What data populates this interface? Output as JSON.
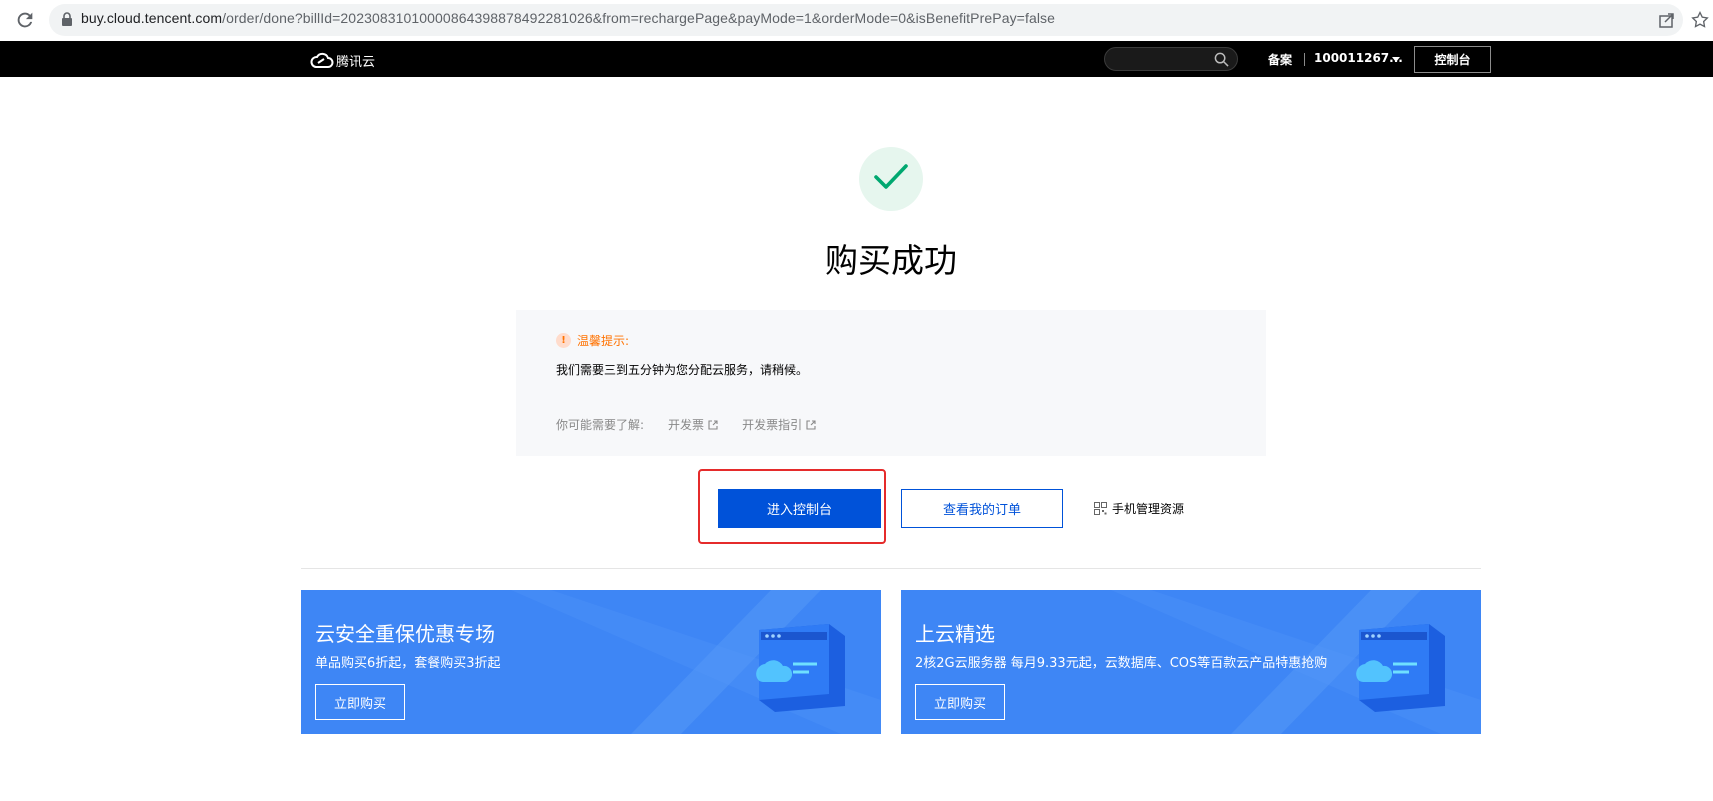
{
  "browser": {
    "url_host": "buy.cloud.tencent.com",
    "url_path": "/order/done?billId=20230831010000864398878492281026&from=rechargePage&payMode=1&orderMode=0&isBenefitPrePay=false"
  },
  "header": {
    "logo_text": "腾讯云",
    "search_placeholder": "",
    "beian": "备案",
    "account": "100011267...",
    "console_button": "控制台"
  },
  "main": {
    "title": "购买成功",
    "notice": {
      "heading": "温馨提示:",
      "body": "我们需要三到五分钟为您分配云服务，请稍候。",
      "links_label": "你可能需要了解:",
      "links": [
        "开发票",
        "开发票指引"
      ]
    },
    "buttons": {
      "enter_console": "进入控制台",
      "view_orders": "查看我的订单",
      "mobile_manage": "手机管理资源"
    }
  },
  "banners": [
    {
      "title": "云安全重保优惠专场",
      "subtitle": "单品购买6折起，套餐购买3折起",
      "button": "立即购买"
    },
    {
      "title": "上云精选",
      "subtitle": "2核2G云服务器 每月9.33元起，云数据库、COS等百款云产品特惠抢购",
      "button": "立即购买"
    }
  ],
  "colors": {
    "primary": "#0052d9",
    "success": "#00a870",
    "warning": "#ff7200",
    "banner": "#3e86f5",
    "highlight": "#e52b2b"
  },
  "icons": [
    "reload-icon",
    "lock-icon",
    "share-icon",
    "star-icon",
    "cloud-logo-icon",
    "search-icon",
    "caret-down-icon",
    "check-icon",
    "warning-icon",
    "external-link-icon",
    "qrcode-icon",
    "browser-window-icon"
  ]
}
